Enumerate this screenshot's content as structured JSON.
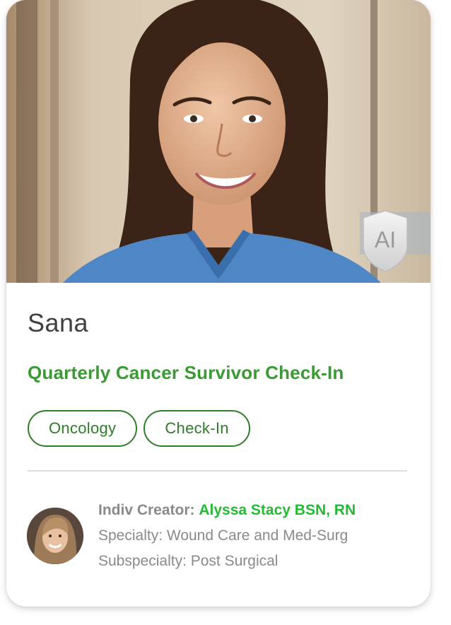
{
  "profile": {
    "name": "Sana",
    "title": "Quarterly Cancer Survivor Check-In",
    "ai_badge": "AI",
    "tags": [
      "Oncology",
      "Check-In"
    ]
  },
  "creator": {
    "label": "Indiv Creator:",
    "name": "Alyssa Stacy BSN, RN",
    "specialty": "Specialty: Wound Care and Med-Surg",
    "subspecialty": "Subspecialty: Post Surgical"
  },
  "colors": {
    "accent_green": "#3a9a33",
    "tag_green": "#2f7d2a",
    "creator_green": "#22bb33",
    "muted_text": "#8a8a8a"
  },
  "icons": {
    "ai_badge": "shield-ai-icon"
  }
}
